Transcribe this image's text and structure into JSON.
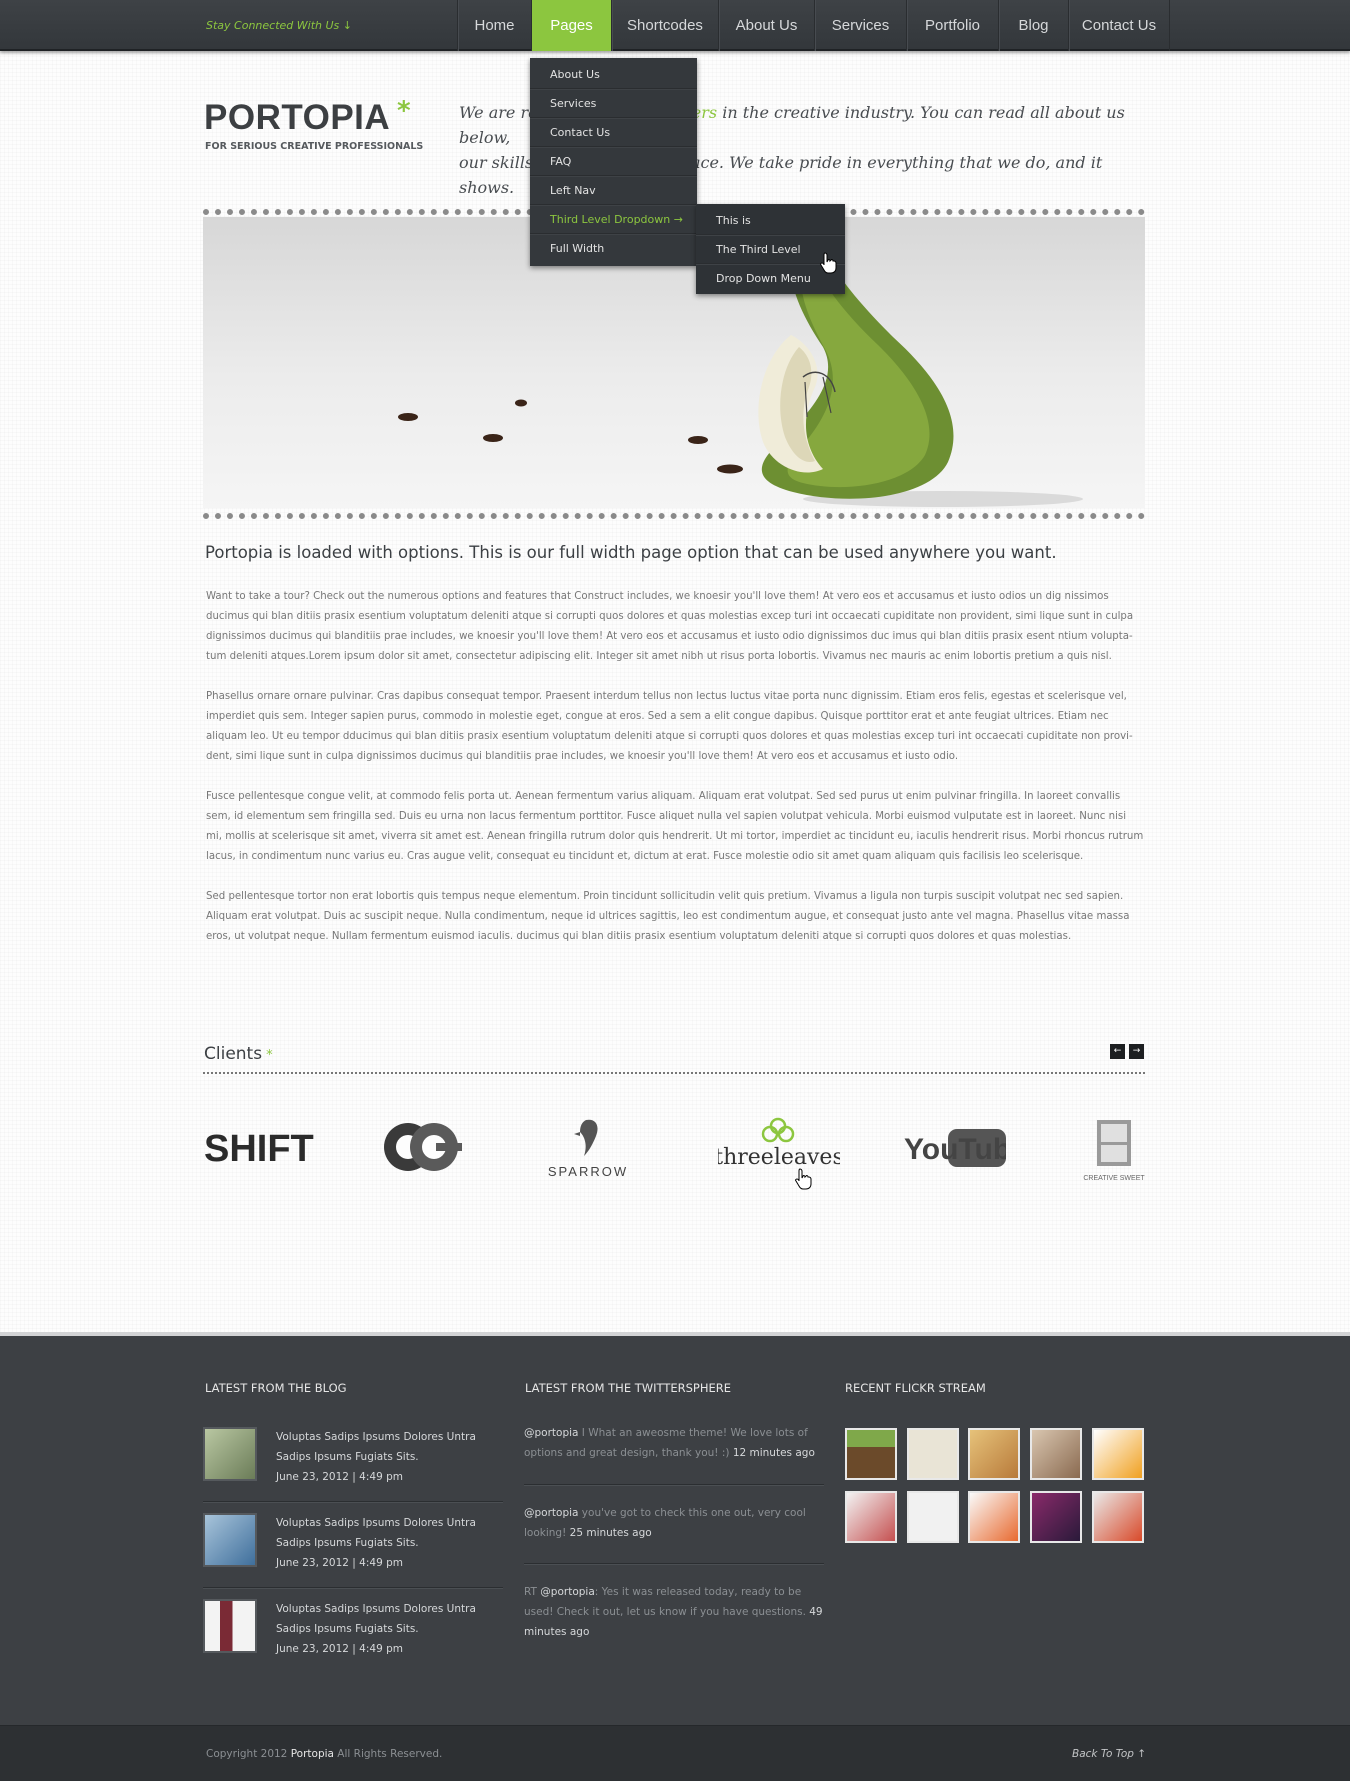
{
  "topbar": {
    "stay_connected": "Stay Connected With Us ↓",
    "nav": [
      "Home",
      "Pages",
      "Shortcodes",
      "About Us",
      "Services",
      "Portfolio",
      "Blog",
      "Contact Us"
    ]
  },
  "dropdown": {
    "items": [
      "About Us",
      "Services",
      "Contact Us",
      "FAQ",
      "Left Nav",
      "Third Level Dropdown  →",
      "Full Width"
    ],
    "submenu": [
      "This is",
      "The Third Level",
      "Drop Down Menu"
    ]
  },
  "header": {
    "logo": "PORTOPIA",
    "logo_mark": "*",
    "tagline": "FOR SERIOUS CREATIVE PROFESSIONALS",
    "intro_a": "We are re",
    "intro_accent": "ders",
    "intro_b": " in the creative industry. You can read all about us below,",
    "intro_c": "our skills,",
    "intro_d": "rkplace. We take pride in everything that we do, and it shows."
  },
  "content": {
    "heading": "Portopia is loaded with options.  This is our full width page option that can be used anywhere you want.",
    "paragraphs": [
      "Want to take a tour?  Check out the numerous options and features that Construct includes, we knoesir you'll love them! At vero eos et accusamus et iusto odios un  dig nissimos ducimus qui blan ditiis prasix esentium voluptatum deleniti atque si corrupti quos dolores et quas molestias excep turi int occaecati cupiditate non provident, simi lique sunt in culpa dignissimos ducimus qui blanditiis prae includes, we knoesir you'll love them! At vero eos et accusamus et iusto odio dignissimos duc imus qui blan ditiis prasix esent ntium volupta-tum deleniti atques.Lorem ipsum dolor sit amet, consectetur adipiscing elit. Integer sit amet nibh ut risus porta lobortis. Vivamus nec mauris ac enim lobortis pretium a quis nisl.",
      "Phasellus ornare ornare pulvinar. Cras dapibus consequat tempor. Praesent interdum tellus non lectus luctus vitae porta nunc dignissim. Etiam eros felis, egestas et scelerisque vel, imperdiet quis sem. Integer sapien purus, commodo in molestie eget, congue at eros. Sed a sem a elit congue dapibus. Quisque porttitor erat et ante feugiat ultrices. Etiam nec aliquam leo. Ut eu tempor dducimus qui blan ditiis prasix esentium voluptatum deleniti atque si corrupti quos dolores et quas molestias excep turi int occaecati cupiditate non provi-dent, simi lique sunt in culpa dignissimos ducimus qui blanditiis prae includes, we knoesir you'll love them! At vero eos et accusamus et iusto odio.",
      "Fusce pellentesque congue velit, at commodo felis porta ut. Aenean fermentum varius aliquam. Aliquam erat volutpat. Sed sed purus ut enim pulvinar fringilla. In laoreet convallis sem, id elementum sem fringilla sed. Duis eu urna non lacus fermentum porttitor. Fusce aliquet nulla vel sapien volutpat vehicula. Morbi euismod vulputate est in laoreet. Nunc nisi mi, mollis at scelerisque sit amet, viverra sit amet est. Aenean fringilla rutrum dolor quis hendrerit. Ut mi tortor, imperdiet ac tincidunt eu, iaculis hendrerit risus. Morbi rhoncus rutrum lacus, in condimentum nunc varius eu. Cras augue velit, consequat eu tincidunt et, dictum at erat. Fusce molestie odio sit amet quam aliquam quis facilisis leo scelerisque.",
      "Sed pellentesque tortor non erat lobortis quis tempus neque elementum. Proin tincidunt sollicitudin velit quis pretium. Vivamus a ligula non turpis suscipit volutpat nec sed sapien. Aliquam erat volutpat. Duis ac suscipit neque. Nulla condimentum, neque id ultrices sagittis, leo est condimentum augue, et consequat justo ante vel magna. Phasellus vitae massa eros, ut volutpat neque. Nullam fermentum euismod iaculis. ducimus qui blan ditiis prasix esentium voluptatum deleniti atque si corrupti quos dolores et quas molestias."
    ]
  },
  "clients": {
    "title": "Clients",
    "star": "*",
    "prev": "←",
    "next": "→",
    "logos": [
      "SHIFT",
      "OC",
      "SPARROW",
      "threeleaves",
      "YouTube",
      "CREATIVE SWEET"
    ]
  },
  "footer": {
    "blog_title": "LATEST FROM THE BLOG",
    "twitter_title": "LATEST FROM THE TWITTERSPHERE",
    "flickr_title": "RECENT FLICKR STREAM",
    "blog_posts": [
      {
        "line1": "Voluptas Sadips Ipsums Dolores Untra",
        "line2": "Sadips Ipsums Fugiats Sits.",
        "date": "June 23, 2012   |   4:49 pm"
      },
      {
        "line1": "Voluptas Sadips Ipsums Dolores Untra",
        "line2": "Sadips Ipsums Fugiats Sits.",
        "date": "June 23, 2012   |   4:49 pm"
      },
      {
        "line1": "Voluptas Sadips Ipsums Dolores Untra",
        "line2": "Sadips Ipsums Fugiats Sits.",
        "date": "June 23, 2012   |   4:49 pm"
      }
    ],
    "tweets": [
      {
        "prefix": "",
        "handle": "@portopia",
        "text": " I What an aweosme theme!  We love lots of options and great design, thank you!  :) ",
        "time": "12 minutes ago"
      },
      {
        "prefix": "",
        "handle": "@portopia",
        "text": " you've got to check this one out, very cool looking! ",
        "time": "25 minutes ago"
      },
      {
        "prefix": "RT ",
        "handle": "@portopia",
        "text": ": Yes it was released today, ready to be used! Check it out, let us know if you have questions. ",
        "time": "49 minutes ago"
      }
    ]
  },
  "bottom": {
    "copyright_a": "Copyright 2012 ",
    "copyright_brand": "Portopia",
    "copyright_b": "  All Rights Reserved.",
    "back_to_top": "Back To Top  ↑"
  }
}
